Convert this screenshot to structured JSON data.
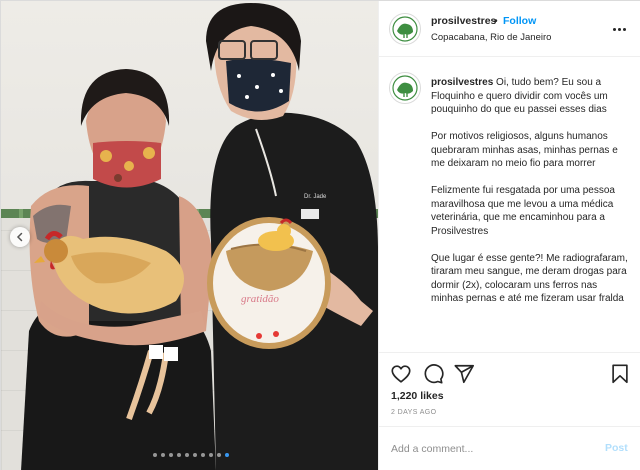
{
  "post": {
    "username": "prosilvestres",
    "separator": "•",
    "follow_label": "Follow",
    "location": "Copacabana, Rio de Janeiro",
    "caption_username": "prosilvestres",
    "caption_paragraphs": [
      "Oi, tudo bem? Eu sou a Floquinho e quero dividir com vocês um pouquinho do que eu passei esses dias",
      "Por motivos religiosos, alguns humanos quebraram minhas asas, minhas pernas e me deixaram no meio fio para morrer",
      "Felizmente fui resgatada por uma pessoa maravilhosa que me levou a uma médica veterinária, que me encaminhou para a Prosilvestres",
      "Que lugar é esse gente?! Me radiografaram, tiraram meu sangue, me deram drogas para dormir (2x), colocaram uns ferros nas minhas pernas e até me fizeram usar fralda"
    ],
    "likes": "1,220 likes",
    "date": "2 DAYS AGO",
    "comment_placeholder": "Add a comment...",
    "post_label": "Post"
  },
  "photo": {
    "embroidery_text": "gratidão",
    "carousel_dot_count": 10,
    "carousel_active_index": 9
  },
  "icons": {
    "more": "more-options-icon",
    "like": "heart-icon",
    "comment": "comment-icon",
    "share": "share-icon",
    "save": "bookmark-icon",
    "carousel": "chevron-left-icon"
  },
  "colors": {
    "follow": "#0095f6",
    "post_disabled": "#b2dffc",
    "secondary_text": "#8e8e8e",
    "active_dot": "#3897f0"
  }
}
